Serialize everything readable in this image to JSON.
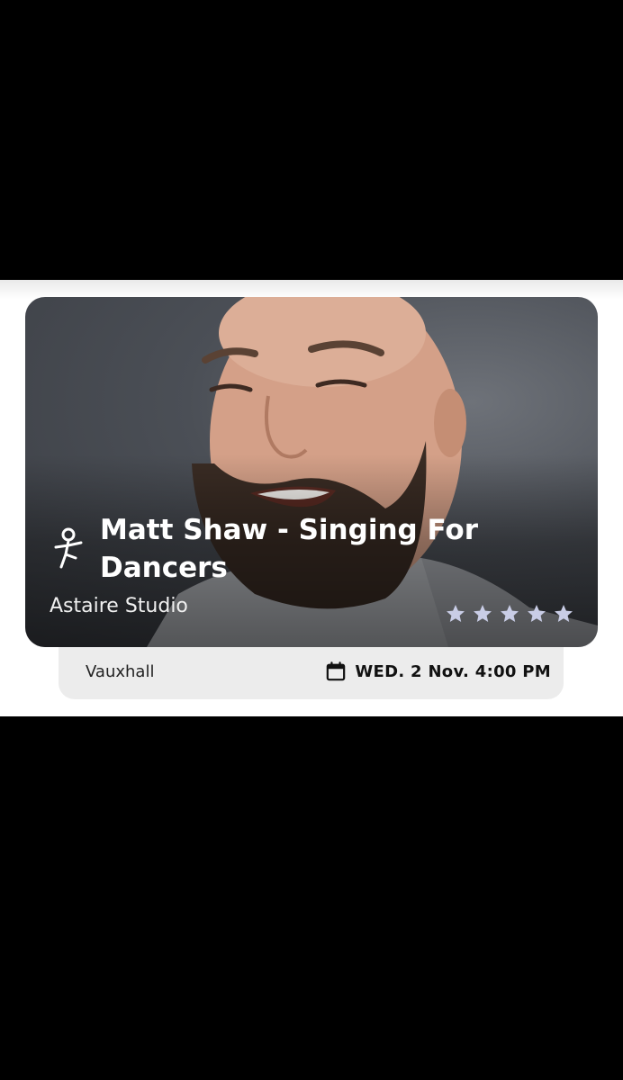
{
  "event": {
    "title": "Matt Shaw - Singing For Dancers",
    "studio": "Astaire Studio",
    "location": "Vauxhall",
    "datetime": "WED. 2 Nov. 4:00 PM",
    "rating": 5,
    "rating_max": 5,
    "category_icon": "dancer-icon",
    "date_icon": "calendar-icon",
    "star_color": "#c9cde6"
  }
}
